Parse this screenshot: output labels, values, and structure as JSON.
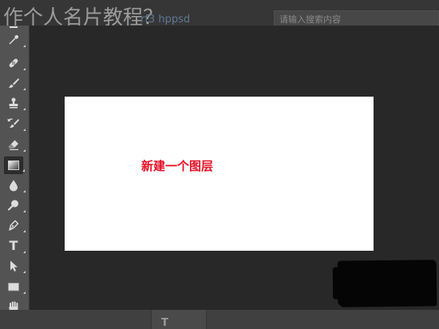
{
  "page": {
    "heading": "作个人名片教程？",
    "heading_link": "rf3 hppsd",
    "search_placeholder": "请输入搜索内容"
  },
  "tools": [
    {
      "name": "eyedropper-tool",
      "icon": "eyedropper-icon"
    },
    {
      "name": "healing-brush-tool",
      "icon": "bandage-icon"
    },
    {
      "name": "brush-tool",
      "icon": "brush-icon"
    },
    {
      "name": "clone-stamp-tool",
      "icon": "stamp-icon"
    },
    {
      "name": "history-brush-tool",
      "icon": "history-brush-icon"
    },
    {
      "name": "eraser-tool",
      "icon": "eraser-icon"
    },
    {
      "name": "gradient-tool",
      "icon": "gradient-icon",
      "active": true
    },
    {
      "name": "blur-tool",
      "icon": "drop-icon"
    },
    {
      "name": "dodge-tool",
      "icon": "dodge-icon"
    },
    {
      "name": "pen-tool",
      "icon": "pen-icon"
    },
    {
      "name": "type-tool",
      "icon": "type-icon",
      "label": "T"
    },
    {
      "name": "path-selection-tool",
      "icon": "arrow-icon"
    },
    {
      "name": "rectangle-tool",
      "icon": "rectangle-icon"
    },
    {
      "name": "hand-tool",
      "icon": "hand-icon"
    }
  ],
  "canvas": {
    "annotation": "新建一个图层",
    "annotation_color": "#e60f24",
    "background": "#ffffff"
  },
  "bottom_bar": {
    "tab_glyph": "T"
  },
  "colors": {
    "panel": "#535353",
    "workspace": "#282828",
    "active_tool": "#2e2e2e"
  }
}
